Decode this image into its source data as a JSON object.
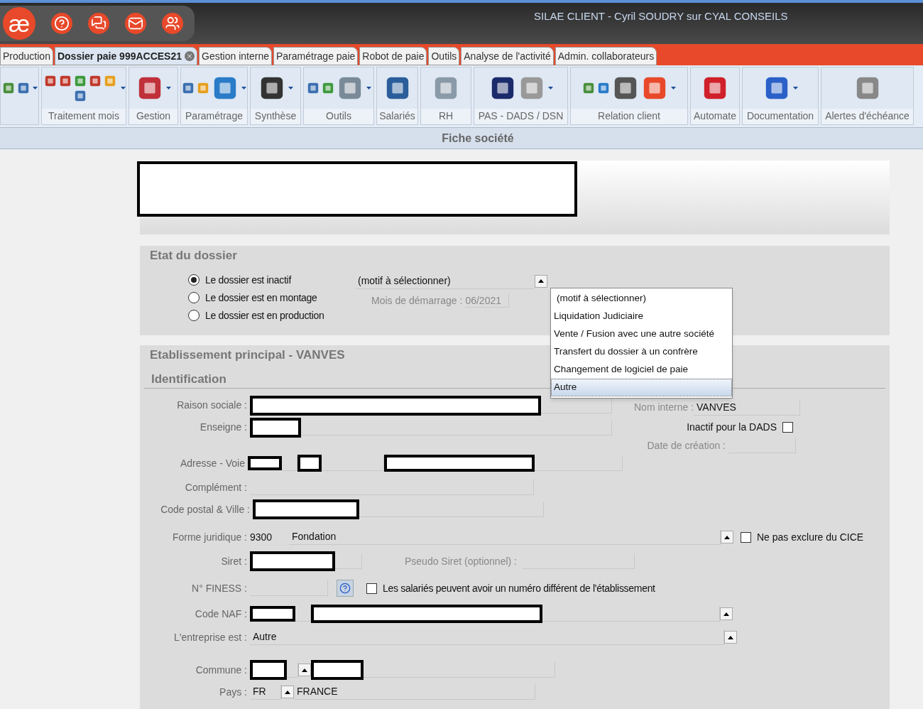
{
  "app": {
    "logo": "æ",
    "title": "SILAE CLIENT - Cyril SOUDRY sur CYAL CONSEILS"
  },
  "tabs": [
    {
      "label": "Production",
      "selected": false,
      "closable": false
    },
    {
      "label": "Dossier paie 999ACCES21",
      "selected": true,
      "closable": true
    },
    {
      "label": "Gestion interne",
      "selected": false,
      "closable": false
    },
    {
      "label": "Paramétrage paie",
      "selected": false,
      "closable": false
    },
    {
      "label": "Robot de paie",
      "selected": false,
      "closable": false
    },
    {
      "label": "Outils",
      "selected": false,
      "closable": false
    },
    {
      "label": "Analyse de l'activité",
      "selected": false,
      "closable": false
    },
    {
      "label": "Admin. collaborateurs",
      "selected": false,
      "closable": false
    }
  ],
  "ribbon": [
    {
      "label": "Traitement mois"
    },
    {
      "label": "Gestion"
    },
    {
      "label": "Paramétrage"
    },
    {
      "label": "Synthèse"
    },
    {
      "label": "Outils"
    },
    {
      "label": "Salariés"
    },
    {
      "label": "RH"
    },
    {
      "label": "PAS - DADS / DSN"
    },
    {
      "label": "Relation client"
    },
    {
      "label": "Automate"
    },
    {
      "label": "Documentation"
    },
    {
      "label": "Alertes d'échéance"
    }
  ],
  "section_title": "Fiche société",
  "etat": {
    "title": "Etat du dossier",
    "options": [
      {
        "label": "Le dossier est inactif",
        "selected": true
      },
      {
        "label": "Le dossier est en montage",
        "selected": false
      },
      {
        "label": "Le dossier est en production",
        "selected": false
      }
    ],
    "motif": "(motif à sélectionner)",
    "start_month": {
      "label": "Mois de démarrage :",
      "value": "06/2021"
    },
    "menu": [
      {
        "label": "(motif à sélectionner)",
        "selected": false
      },
      {
        "label": "Liquidation Judiciaire",
        "selected": false
      },
      {
        "label": "Vente / Fusion avec une autre société",
        "selected": false
      },
      {
        "label": "Transfert du dossier à un confrère",
        "selected": false
      },
      {
        "label": "Changement de logiciel de paie",
        "selected": false
      },
      {
        "label": "Autre",
        "selected": true
      }
    ]
  },
  "etab": {
    "title": "Etablissement principal - VANVES",
    "subtitle": "Identification",
    "raison": "Raison sociale :",
    "enseigne": "Enseigne :",
    "adresse": "Adresse - Voie",
    "complement": "Complément :",
    "cp": "Code postal & Ville :",
    "nom_interne": {
      "label": "Nom interne :",
      "value": "VANVES"
    },
    "inactif_dads": {
      "label": "Inactif pour la DADS",
      "checked": false
    },
    "date_creation": "Date de création :",
    "forme": {
      "label": "Forme juridique :",
      "code": "9300",
      "value": "Fondation"
    },
    "cice": {
      "label": "Ne pas exclure du CICE",
      "checked": false
    },
    "siret": "Siret :",
    "pseudo_siret": "Pseudo Siret (optionnel) :",
    "finess": "N° FINESS :",
    "salaries": {
      "label": "Les salariés peuvent avoir un numéro différent de l'établissement",
      "checked": false
    },
    "naf": "Code NAF :",
    "entreprise": {
      "label": "L'entreprise est :",
      "value": "Autre"
    },
    "commune": "Commune :",
    "pays": {
      "label": "Pays :",
      "code": "FR",
      "value": "FRANCE"
    }
  }
}
